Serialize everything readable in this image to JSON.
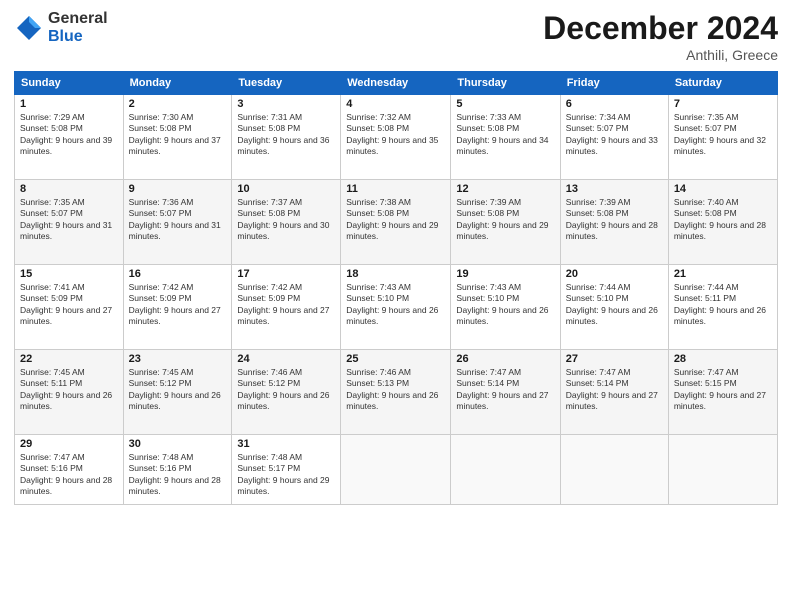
{
  "header": {
    "logo_general": "General",
    "logo_blue": "Blue",
    "month_year": "December 2024",
    "location": "Anthili, Greece"
  },
  "days_of_week": [
    "Sunday",
    "Monday",
    "Tuesday",
    "Wednesday",
    "Thursday",
    "Friday",
    "Saturday"
  ],
  "weeks": [
    [
      {
        "num": "1",
        "sunrise": "Sunrise: 7:29 AM",
        "sunset": "Sunset: 5:08 PM",
        "daylight": "Daylight: 9 hours and 39 minutes."
      },
      {
        "num": "2",
        "sunrise": "Sunrise: 7:30 AM",
        "sunset": "Sunset: 5:08 PM",
        "daylight": "Daylight: 9 hours and 37 minutes."
      },
      {
        "num": "3",
        "sunrise": "Sunrise: 7:31 AM",
        "sunset": "Sunset: 5:08 PM",
        "daylight": "Daylight: 9 hours and 36 minutes."
      },
      {
        "num": "4",
        "sunrise": "Sunrise: 7:32 AM",
        "sunset": "Sunset: 5:08 PM",
        "daylight": "Daylight: 9 hours and 35 minutes."
      },
      {
        "num": "5",
        "sunrise": "Sunrise: 7:33 AM",
        "sunset": "Sunset: 5:08 PM",
        "daylight": "Daylight: 9 hours and 34 minutes."
      },
      {
        "num": "6",
        "sunrise": "Sunrise: 7:34 AM",
        "sunset": "Sunset: 5:07 PM",
        "daylight": "Daylight: 9 hours and 33 minutes."
      },
      {
        "num": "7",
        "sunrise": "Sunrise: 7:35 AM",
        "sunset": "Sunset: 5:07 PM",
        "daylight": "Daylight: 9 hours and 32 minutes."
      }
    ],
    [
      {
        "num": "8",
        "sunrise": "Sunrise: 7:35 AM",
        "sunset": "Sunset: 5:07 PM",
        "daylight": "Daylight: 9 hours and 31 minutes."
      },
      {
        "num": "9",
        "sunrise": "Sunrise: 7:36 AM",
        "sunset": "Sunset: 5:07 PM",
        "daylight": "Daylight: 9 hours and 31 minutes."
      },
      {
        "num": "10",
        "sunrise": "Sunrise: 7:37 AM",
        "sunset": "Sunset: 5:08 PM",
        "daylight": "Daylight: 9 hours and 30 minutes."
      },
      {
        "num": "11",
        "sunrise": "Sunrise: 7:38 AM",
        "sunset": "Sunset: 5:08 PM",
        "daylight": "Daylight: 9 hours and 29 minutes."
      },
      {
        "num": "12",
        "sunrise": "Sunrise: 7:39 AM",
        "sunset": "Sunset: 5:08 PM",
        "daylight": "Daylight: 9 hours and 29 minutes."
      },
      {
        "num": "13",
        "sunrise": "Sunrise: 7:39 AM",
        "sunset": "Sunset: 5:08 PM",
        "daylight": "Daylight: 9 hours and 28 minutes."
      },
      {
        "num": "14",
        "sunrise": "Sunrise: 7:40 AM",
        "sunset": "Sunset: 5:08 PM",
        "daylight": "Daylight: 9 hours and 28 minutes."
      }
    ],
    [
      {
        "num": "15",
        "sunrise": "Sunrise: 7:41 AM",
        "sunset": "Sunset: 5:09 PM",
        "daylight": "Daylight: 9 hours and 27 minutes."
      },
      {
        "num": "16",
        "sunrise": "Sunrise: 7:42 AM",
        "sunset": "Sunset: 5:09 PM",
        "daylight": "Daylight: 9 hours and 27 minutes."
      },
      {
        "num": "17",
        "sunrise": "Sunrise: 7:42 AM",
        "sunset": "Sunset: 5:09 PM",
        "daylight": "Daylight: 9 hours and 27 minutes."
      },
      {
        "num": "18",
        "sunrise": "Sunrise: 7:43 AM",
        "sunset": "Sunset: 5:10 PM",
        "daylight": "Daylight: 9 hours and 26 minutes."
      },
      {
        "num": "19",
        "sunrise": "Sunrise: 7:43 AM",
        "sunset": "Sunset: 5:10 PM",
        "daylight": "Daylight: 9 hours and 26 minutes."
      },
      {
        "num": "20",
        "sunrise": "Sunrise: 7:44 AM",
        "sunset": "Sunset: 5:10 PM",
        "daylight": "Daylight: 9 hours and 26 minutes."
      },
      {
        "num": "21",
        "sunrise": "Sunrise: 7:44 AM",
        "sunset": "Sunset: 5:11 PM",
        "daylight": "Daylight: 9 hours and 26 minutes."
      }
    ],
    [
      {
        "num": "22",
        "sunrise": "Sunrise: 7:45 AM",
        "sunset": "Sunset: 5:11 PM",
        "daylight": "Daylight: 9 hours and 26 minutes."
      },
      {
        "num": "23",
        "sunrise": "Sunrise: 7:45 AM",
        "sunset": "Sunset: 5:12 PM",
        "daylight": "Daylight: 9 hours and 26 minutes."
      },
      {
        "num": "24",
        "sunrise": "Sunrise: 7:46 AM",
        "sunset": "Sunset: 5:12 PM",
        "daylight": "Daylight: 9 hours and 26 minutes."
      },
      {
        "num": "25",
        "sunrise": "Sunrise: 7:46 AM",
        "sunset": "Sunset: 5:13 PM",
        "daylight": "Daylight: 9 hours and 26 minutes."
      },
      {
        "num": "26",
        "sunrise": "Sunrise: 7:47 AM",
        "sunset": "Sunset: 5:14 PM",
        "daylight": "Daylight: 9 hours and 27 minutes."
      },
      {
        "num": "27",
        "sunrise": "Sunrise: 7:47 AM",
        "sunset": "Sunset: 5:14 PM",
        "daylight": "Daylight: 9 hours and 27 minutes."
      },
      {
        "num": "28",
        "sunrise": "Sunrise: 7:47 AM",
        "sunset": "Sunset: 5:15 PM",
        "daylight": "Daylight: 9 hours and 27 minutes."
      }
    ],
    [
      {
        "num": "29",
        "sunrise": "Sunrise: 7:47 AM",
        "sunset": "Sunset: 5:16 PM",
        "daylight": "Daylight: 9 hours and 28 minutes."
      },
      {
        "num": "30",
        "sunrise": "Sunrise: 7:48 AM",
        "sunset": "Sunset: 5:16 PM",
        "daylight": "Daylight: 9 hours and 28 minutes."
      },
      {
        "num": "31",
        "sunrise": "Sunrise: 7:48 AM",
        "sunset": "Sunset: 5:17 PM",
        "daylight": "Daylight: 9 hours and 29 minutes."
      },
      null,
      null,
      null,
      null
    ]
  ]
}
